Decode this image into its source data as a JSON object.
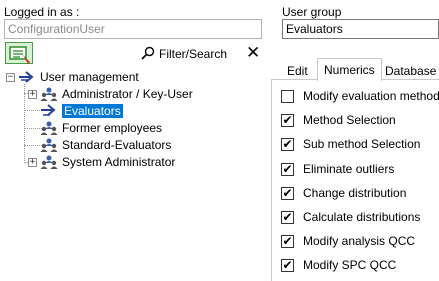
{
  "login": {
    "label": "Logged in as :",
    "value": "ConfigurationUser"
  },
  "user_group": {
    "label": "User group",
    "value": "Evaluators"
  },
  "toolbar": {
    "filter_label": "Filter/Search",
    "close_glyph": "✕"
  },
  "tree": {
    "root": "User management",
    "children": [
      {
        "label": "Administrator / Key-User",
        "expander": "+"
      },
      {
        "label": "Evaluators",
        "selected": true
      },
      {
        "label": "Former employees"
      },
      {
        "label": "Standard-Evaluators"
      },
      {
        "label": "System Administrator",
        "expander": "+"
      }
    ],
    "root_expander": "−"
  },
  "tabs": [
    {
      "label": "Edit"
    },
    {
      "label": "Numerics",
      "active": true
    },
    {
      "label": "Database"
    }
  ],
  "permissions": [
    {
      "label": "Modify evaluation method",
      "checked": false
    },
    {
      "label": "Method Selection",
      "checked": true
    },
    {
      "label": "Sub method Selection",
      "checked": true
    },
    {
      "label": "Eliminate outliers",
      "checked": true
    },
    {
      "label": "Change distribution",
      "checked": true
    },
    {
      "label": "Calculate distributions",
      "checked": true
    },
    {
      "label": "Modify analysis QCC",
      "checked": true
    },
    {
      "label": "Modify SPC QCC",
      "checked": true
    }
  ],
  "check_glyph": "✔",
  "colors": {
    "selection": "#0078d7",
    "icon_green": "#2f8f2f",
    "icon_red": "#c0392b",
    "group_icon": "#3a5fa8"
  }
}
